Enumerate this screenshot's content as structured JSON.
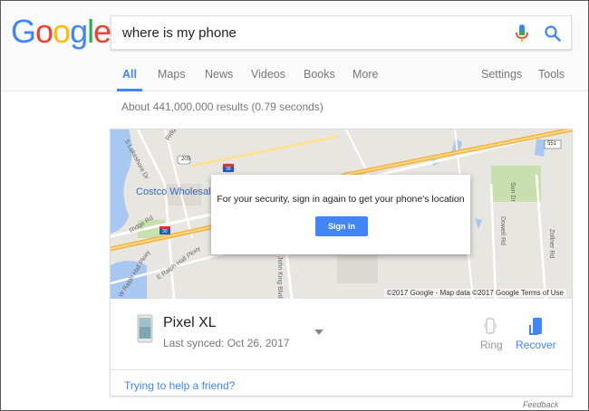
{
  "logo": {
    "letters": [
      "G",
      "o",
      "o",
      "g",
      "l",
      "e"
    ],
    "colors": [
      "#4285f4",
      "#ea4335",
      "#fbbc05",
      "#4285f4",
      "#34a853",
      "#ea4335"
    ]
  },
  "search": {
    "query": "where is my phone",
    "mic_icon": "mic-icon",
    "search_icon": "search-icon"
  },
  "tabs": [
    {
      "label": "All",
      "active": true
    },
    {
      "label": "Maps"
    },
    {
      "label": "News"
    },
    {
      "label": "Videos"
    },
    {
      "label": "Books"
    },
    {
      "label": "More"
    },
    {
      "label": "Settings"
    },
    {
      "label": "Tools"
    }
  ],
  "result_stats": "About 441,000,000 results (0.79 seconds)",
  "map": {
    "labels": {
      "road1": "S Lakeshore Dr",
      "road2": "Ridge Rd",
      "road3": "Ridge Rd",
      "road4": "W Ralph Hall Pkwy",
      "road5": "E Ralph Hall Pkwy",
      "road6": "John King Blvd",
      "road7": "Dowell Rd",
      "road8": "Sun Dr",
      "road9": "Zollner Rd",
      "shield_205": "205",
      "shield_30a": "30",
      "shield_30b": "30",
      "shield_551": "551"
    },
    "place": "Costco Wholesale",
    "credit": "©2017 Google - Map data ©2017 Google   Terms of Use"
  },
  "signin": {
    "message": "For your security, sign in again to get your phone's location",
    "button": "Sign in"
  },
  "device": {
    "name": "Pixel XL",
    "last_synced": "Last synced: Oct 26, 2017",
    "ring_label": "Ring",
    "recover_label": "Recover"
  },
  "help_link": "Trying to help a friend?",
  "feedback": "Feedback",
  "colors": {
    "accent": "#4285f4",
    "map_bg": "#e8e6e1",
    "highway": "#f6b44a",
    "water": "#a9c8f1",
    "park": "#c8dfb0"
  }
}
